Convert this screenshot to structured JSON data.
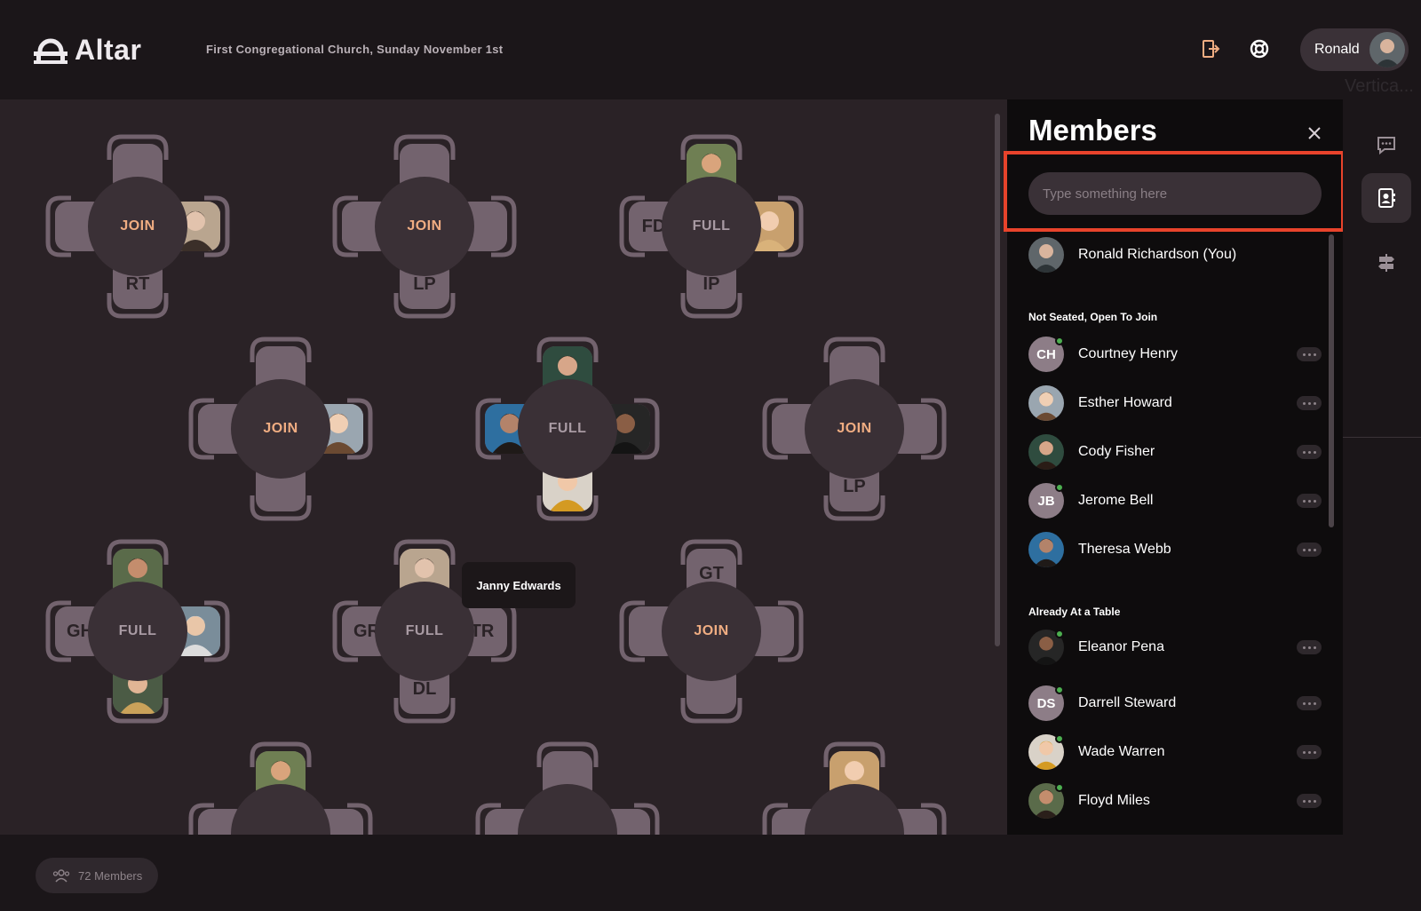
{
  "app": {
    "name": "Altar"
  },
  "header": {
    "event_title": "First Congregational Church, Sunday November 1st",
    "user_name": "Ronald",
    "ghost_text": "Vertica..."
  },
  "colors": {
    "accent": "#f0ad82",
    "highlight": "#e8432b",
    "online": "#4caf50"
  },
  "room": {
    "tooltip": "Janny Edwards",
    "tables": [
      {
        "id": "t1",
        "status": "JOIN",
        "seats": {
          "top": "",
          "left": "",
          "right": "photo",
          "bottom": "RT"
        }
      },
      {
        "id": "t2",
        "status": "JOIN",
        "seats": {
          "top": "",
          "left": "",
          "right": "",
          "bottom": "LP"
        }
      },
      {
        "id": "t3",
        "status": "FULL",
        "seats": {
          "top": "photo",
          "left": "FD",
          "right": "photo",
          "bottom": "IP"
        }
      },
      {
        "id": "t4",
        "status": "JOIN",
        "seats": {
          "top": "",
          "left": "",
          "right": "photo",
          "bottom": ""
        }
      },
      {
        "id": "t5",
        "status": "FULL",
        "seats": {
          "top": "photo",
          "left": "photo",
          "right": "photo",
          "bottom": "photo"
        }
      },
      {
        "id": "t6",
        "status": "JOIN",
        "seats": {
          "top": "",
          "left": "",
          "right": "",
          "bottom": "LP"
        }
      },
      {
        "id": "t7",
        "status": "FULL",
        "seats": {
          "top": "photo",
          "left": "GH",
          "right": "photo",
          "bottom": "photo"
        }
      },
      {
        "id": "t8",
        "status": "FULL",
        "seats": {
          "top": "photo",
          "left": "GR",
          "right": "TR",
          "bottom": "DL"
        }
      },
      {
        "id": "t9",
        "status": "JOIN",
        "seats": {
          "top": "GT",
          "left": "",
          "right": "",
          "bottom": ""
        }
      }
    ]
  },
  "bottom": {
    "members_count_label": "72 Members"
  },
  "panel": {
    "title": "Members",
    "search_placeholder": "Type something here",
    "self": {
      "name": "Ronald Richardson (You)"
    },
    "sections": [
      {
        "label": "Not Seated, Open To Join",
        "members": [
          {
            "name": "Courtney Henry",
            "initials": "CH",
            "online": true
          },
          {
            "name": "Esther Howard",
            "initials": "",
            "online": false
          },
          {
            "name": "Cody Fisher",
            "initials": "",
            "online": false
          },
          {
            "name": "Jerome Bell",
            "initials": "JB",
            "online": true
          },
          {
            "name": "Theresa Webb",
            "initials": "",
            "online": false
          }
        ]
      },
      {
        "label": "Already At a Table",
        "members": [
          {
            "name": "Eleanor Pena",
            "initials": "",
            "online": true
          },
          {
            "name": "Darrell Steward",
            "initials": "DS",
            "online": true
          },
          {
            "name": "Wade Warren",
            "initials": "",
            "online": true
          },
          {
            "name": "Floyd Miles",
            "initials": "",
            "online": true
          }
        ]
      }
    ]
  },
  "icons": {
    "exit": "door-exit-icon",
    "help": "lifebuoy-icon",
    "chat": "chat-bubble-icon",
    "contacts": "contact-card-icon",
    "signpost": "signpost-icon",
    "close": "close-icon",
    "people": "people-icon"
  }
}
